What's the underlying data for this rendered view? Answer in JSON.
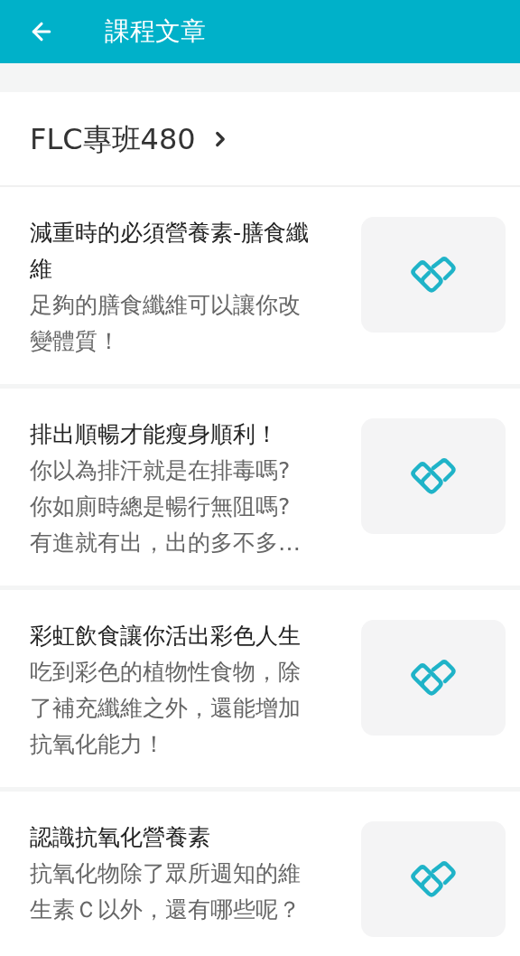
{
  "app_bar": {
    "title": "課程文章"
  },
  "course": {
    "title": "FLC專班480"
  },
  "articles": [
    {
      "title": "減重時的必須營養素-膳食纖維",
      "description": "足夠的膳食纖維可以讓你改變體質！"
    },
    {
      "title": "排出順暢才能瘦身順利！",
      "description": "你以為排汗就是在排毒嗎?\n你如廁時總是暢行無阻嗎?\n有進就有出，出的多不多…"
    },
    {
      "title": "彩虹飲食讓你活出彩色人生",
      "description": "吃到彩色的植物性食物，除了補充纖維之外，還能增加抗氧化能力！"
    },
    {
      "title": "認識抗氧化營養素",
      "description": "抗氧化物除了眾所週知的維生素Ｃ以外，還有哪些呢？"
    }
  ]
}
